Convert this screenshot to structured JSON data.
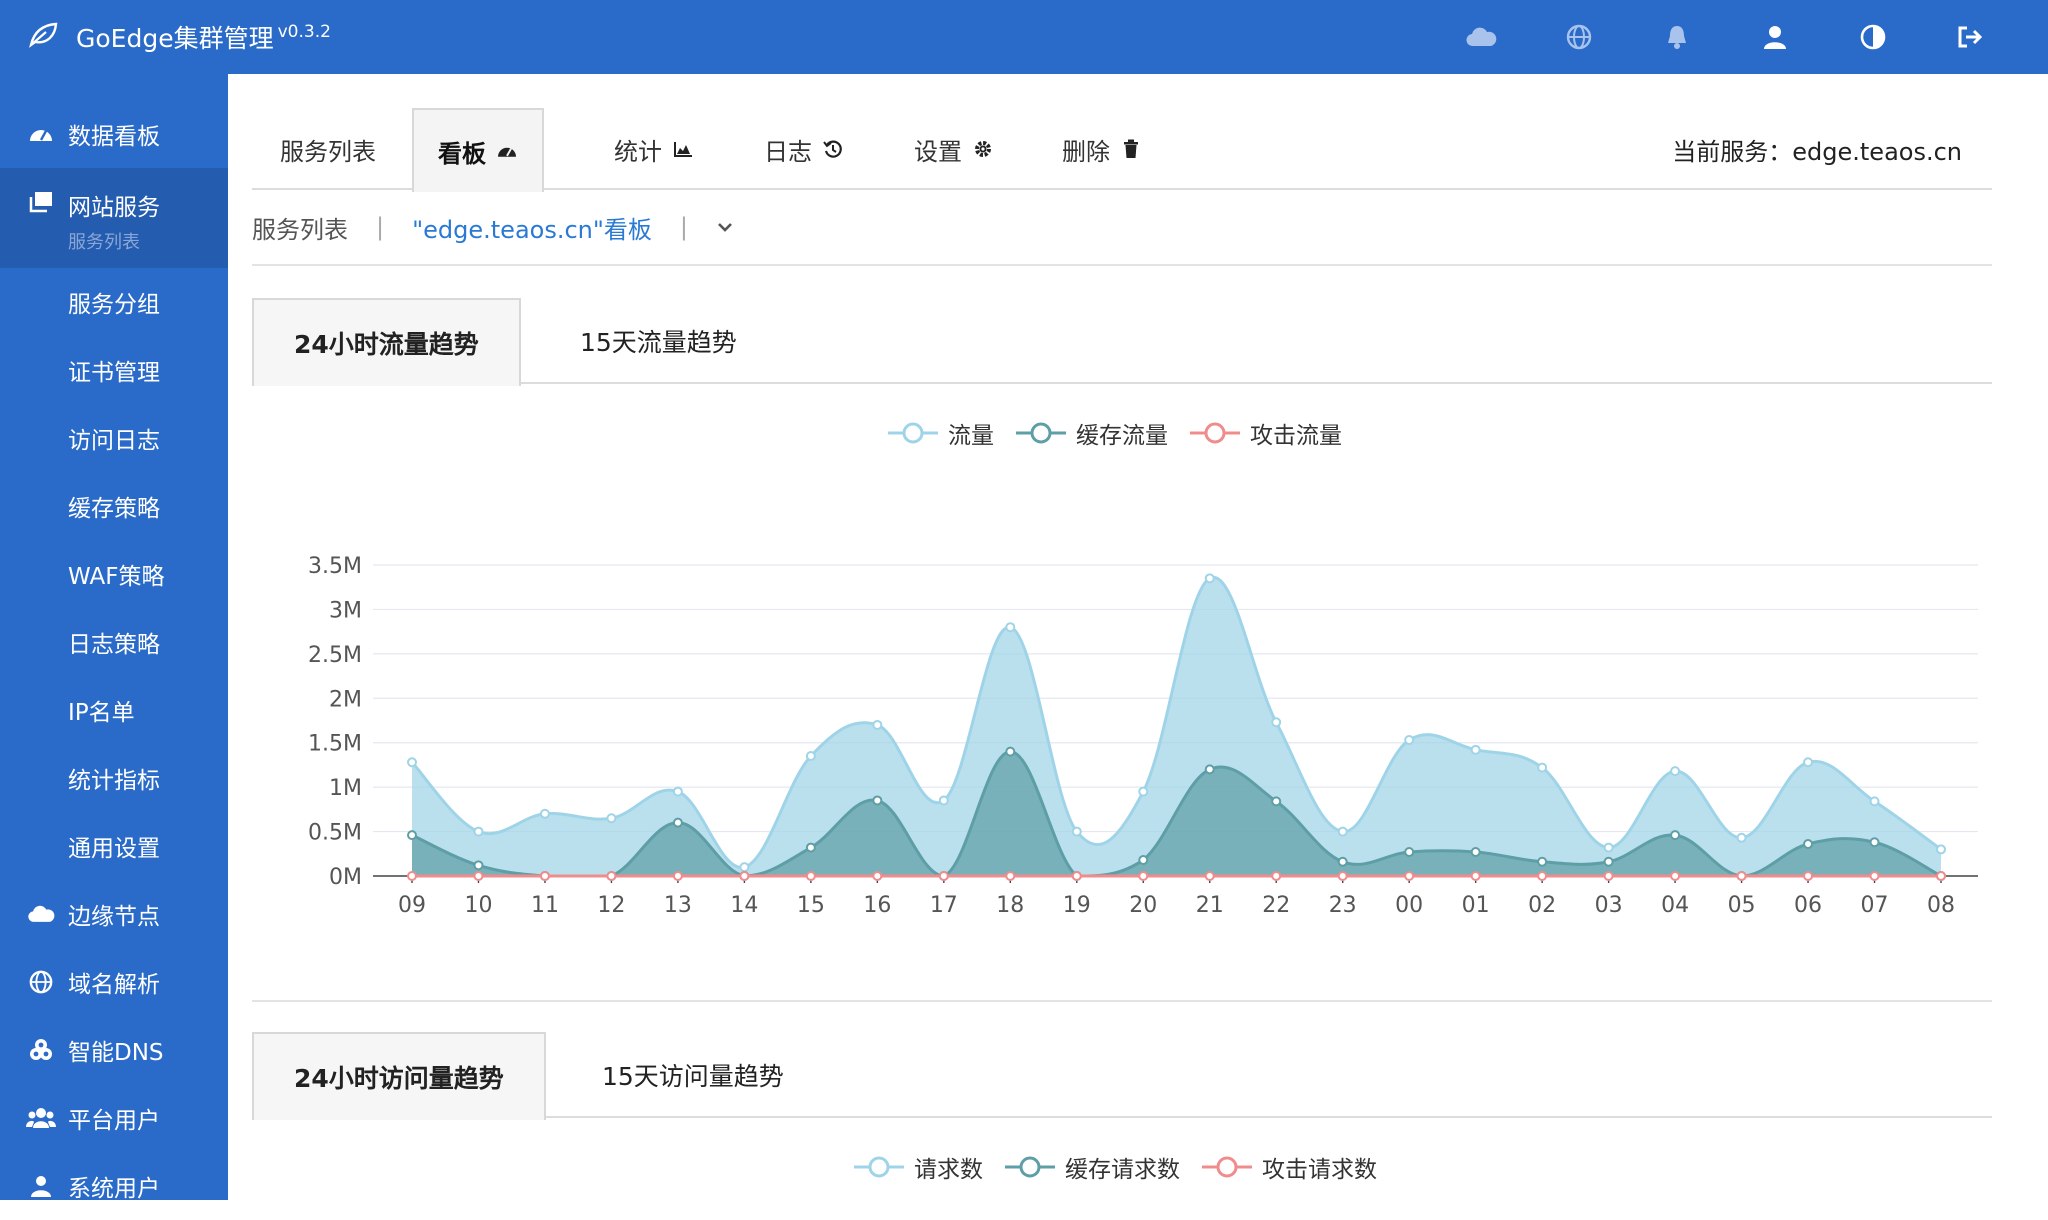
{
  "app": {
    "title": "GoEdge集群管理",
    "version": "v0.3.2"
  },
  "top_icons": [
    "cloud-icon",
    "globe-icon",
    "bell-icon",
    "user-icon",
    "contrast-icon",
    "logout-icon"
  ],
  "sidebar": {
    "items": [
      {
        "label": "数据看板",
        "icon": "dashboard-icon"
      },
      {
        "label": "网站服务",
        "sub": "服务列表",
        "icon": "website-icon",
        "active": true
      }
    ],
    "subitems": [
      "服务分组",
      "证书管理",
      "访问日志",
      "缓存策略",
      "WAF策略",
      "日志策略",
      "IP名单",
      "统计指标",
      "通用设置"
    ],
    "bottom_items": [
      {
        "label": "边缘节点",
        "icon": "cloud-icon"
      },
      {
        "label": "域名解析",
        "icon": "globe-icon"
      },
      {
        "label": "智能DNS",
        "icon": "dns-icon"
      },
      {
        "label": "平台用户",
        "icon": "users-icon"
      },
      {
        "label": "系统用户",
        "icon": "admin-icon"
      }
    ]
  },
  "tabs": [
    {
      "label": "服务列表",
      "icon": ""
    },
    {
      "label": "看板",
      "icon": "dashboard-icon",
      "active": true
    },
    {
      "label": "统计",
      "icon": "area-chart-icon"
    },
    {
      "label": "日志",
      "icon": "history-icon"
    },
    {
      "label": "设置",
      "icon": "gear-icon"
    },
    {
      "label": "删除",
      "icon": "trash-icon"
    }
  ],
  "current_service": "当前服务：edge.teaos.cn",
  "breadcrumb": {
    "first": "服务列表",
    "second": "\"edge.teaos.cn\"看板"
  },
  "traffic_tabs": [
    "24小时流量趋势",
    "15天流量趋势"
  ],
  "request_tabs": [
    "24小时访问量趋势",
    "15天访问量趋势"
  ],
  "traffic_legend": [
    "流量",
    "缓存流量",
    "攻击流量"
  ],
  "request_legend": [
    "请求数",
    "缓存请求数",
    "攻击请求数"
  ],
  "colors": {
    "primary": "#2a6bc9",
    "traffic": "#9fd4e8",
    "cache": "#5e9ea6",
    "attack": "#f08c8c"
  },
  "chart_data": {
    "type": "area",
    "categories": [
      "09",
      "10",
      "11",
      "12",
      "13",
      "14",
      "15",
      "16",
      "17",
      "18",
      "19",
      "20",
      "21",
      "22",
      "23",
      "00",
      "01",
      "02",
      "03",
      "04",
      "05",
      "06",
      "07",
      "08"
    ],
    "series": [
      {
        "name": "流量",
        "values": [
          1.28,
          0.5,
          0.7,
          0.65,
          0.95,
          0.1,
          1.35,
          1.7,
          0.85,
          2.8,
          0.5,
          0.95,
          3.35,
          1.73,
          0.5,
          1.53,
          1.42,
          1.22,
          0.32,
          1.18,
          0.43,
          1.28,
          0.84,
          0.3
        ]
      },
      {
        "name": "缓存流量",
        "values": [
          0.46,
          0.12,
          0.0,
          0.0,
          0.6,
          0.0,
          0.32,
          0.85,
          0.0,
          1.4,
          0.0,
          0.18,
          1.2,
          0.84,
          0.16,
          0.27,
          0.27,
          0.16,
          0.16,
          0.46,
          0.0,
          0.36,
          0.38,
          0.0
        ]
      },
      {
        "name": "攻击流量",
        "values": [
          0,
          0,
          0,
          0,
          0,
          0,
          0,
          0,
          0,
          0,
          0,
          0,
          0,
          0,
          0,
          0,
          0,
          0,
          0,
          0,
          0,
          0,
          0,
          0
        ]
      }
    ],
    "y_ticks": [
      "0M",
      "0.5M",
      "1M",
      "1.5M",
      "2M",
      "2.5M",
      "3M",
      "3.5M"
    ],
    "ylim": [
      0,
      3.5
    ]
  }
}
